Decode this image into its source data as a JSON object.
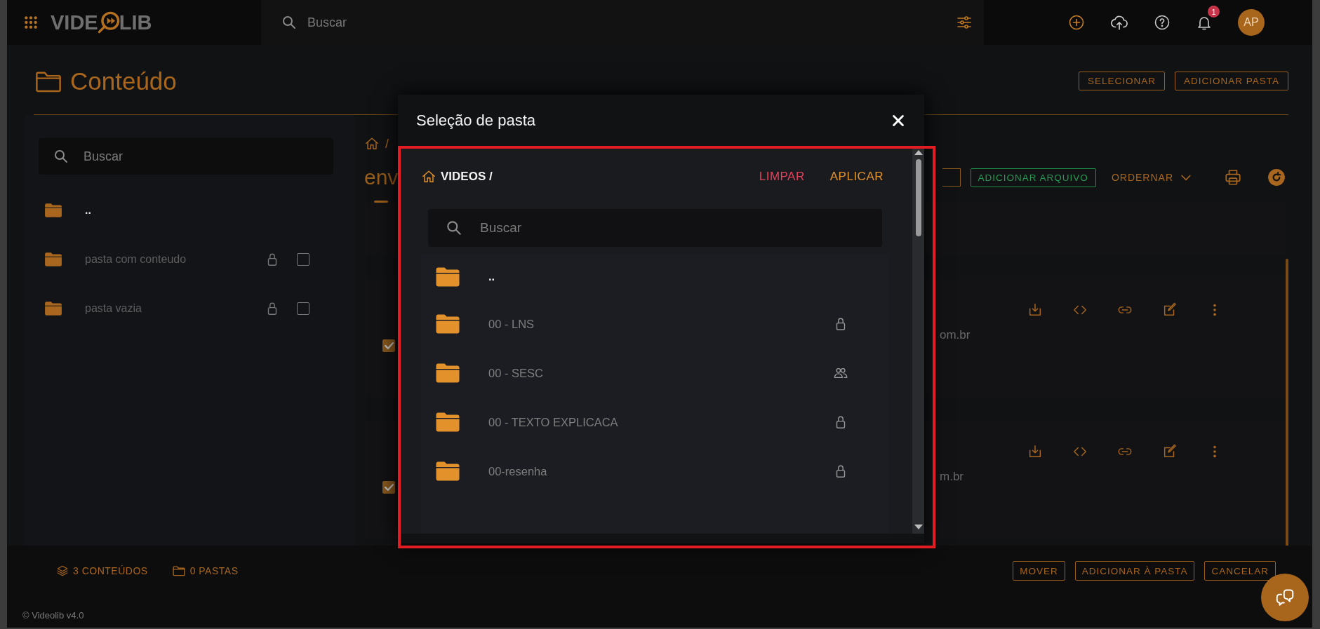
{
  "topbar": {
    "logo": {
      "before": "VIDE",
      "after": "LIB"
    },
    "search": {
      "placeholder": "Buscar"
    },
    "notification_count": "1",
    "avatar_initials": "AP"
  },
  "page": {
    "title": "Conteúdo",
    "buttons": [
      "SELECIONAR",
      "ADICIONAR PASTA"
    ]
  },
  "sidebar": {
    "search": {
      "placeholder": "Buscar"
    },
    "folders": [
      {
        "kind": "parent",
        "name": ".."
      },
      {
        "kind": "folder",
        "name": "pasta com conteudo",
        "shared": false,
        "checked": false
      },
      {
        "kind": "folder",
        "name": "pasta vazia",
        "shared": false,
        "checked": false
      }
    ]
  },
  "content": {
    "breadcrumb_separator": "/",
    "title": "env",
    "toolbar": {
      "add_file": "ADICIONAR ARQUIVO",
      "sort": "ORDERNAR"
    },
    "items": [
      {
        "checked": true,
        "url_fragment": "om.br"
      },
      {
        "checked": true,
        "url_fragment": "m.br"
      }
    ]
  },
  "footer": {
    "contents_count": "3 CONTEÚDOS",
    "folders_count": "0 PASTAS",
    "buttons": [
      "MOVER",
      "ADICIONAR À PASTA",
      "CANCELAR"
    ],
    "copyright": "© Videolib v4.0"
  },
  "modal": {
    "title": "Seleção de pasta",
    "breadcrumb": "VIDEOS /",
    "clear": "LIMPAR",
    "apply": "APLICAR",
    "search": {
      "placeholder": "Buscar"
    },
    "folders": [
      {
        "kind": "parent",
        "name": ".."
      },
      {
        "kind": "folder",
        "name": "00 - LNS",
        "shared": false
      },
      {
        "kind": "folder",
        "name": "00 - SESC",
        "shared": true
      },
      {
        "kind": "folder",
        "name": "00 - TEXTO EXPLICACA",
        "shared": false
      },
      {
        "kind": "folder",
        "name": "00-resenha",
        "shared": false
      }
    ]
  }
}
